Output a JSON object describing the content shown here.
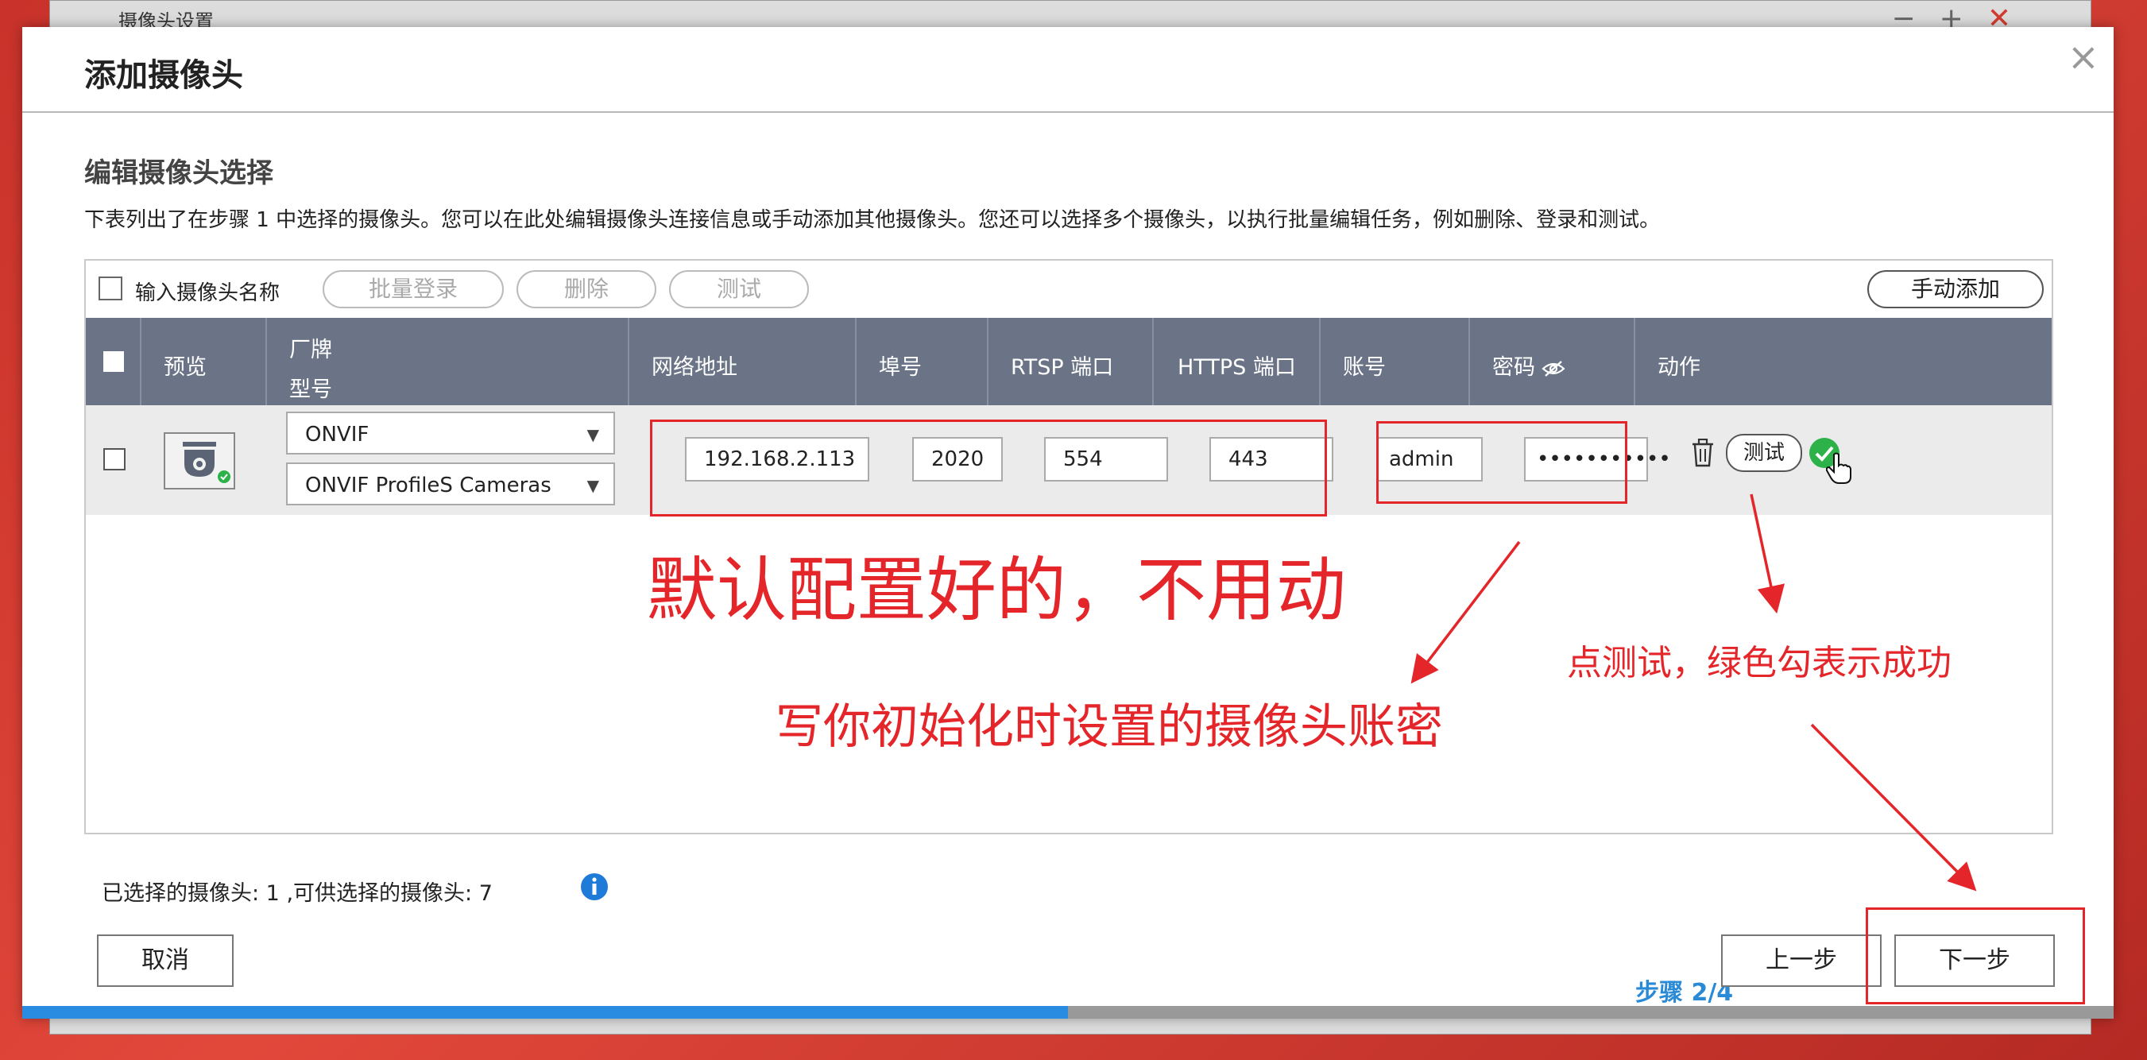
{
  "background_window": {
    "title": "摄像头设置"
  },
  "dialog": {
    "title": "添加摄像头",
    "section_title": "编辑摄像头选择",
    "description": "下表列出了在步骤 1 中选择的摄像头。您可以在此处编辑摄像头连接信息或手动添加其他摄像头。您还可以选择多个摄像头，以执行批量编辑任务，例如删除、登录和测试。"
  },
  "toolbar": {
    "name_label": "输入摄像头名称",
    "batch_login": "批量登录",
    "delete": "删除",
    "test": "测试",
    "manual_add": "手动添加"
  },
  "table": {
    "headers": {
      "preview": "预览",
      "brand": "厂牌",
      "model": "型号",
      "network_address": "网络地址",
      "port": "埠号",
      "rtsp_port": "RTSP 端口",
      "https_port": "HTTPS 端口",
      "account": "账号",
      "password": "密码",
      "action": "动作"
    },
    "row": {
      "brand": "ONVIF",
      "model": "ONVIF ProfileS Cameras",
      "ip": "192.168.2.113",
      "port": "2020",
      "rtsp": "554",
      "https": "443",
      "account": "admin",
      "password_mask": "•••••••••••",
      "test": "测试"
    }
  },
  "summary": {
    "text": "已选择的摄像头:  1  ,可供选择的摄像头:  7"
  },
  "footer": {
    "cancel": "取消",
    "step": "步骤 2/4",
    "prev": "上一步",
    "next": "下一步"
  },
  "progress": {
    "fraction": 0.5
  },
  "annotations": {
    "default_config": "默认配置好的，不用动",
    "account_hint": "写你初始化时设置的摄像头账密",
    "test_hint": "点测试，绿色勾表示成功"
  },
  "colors": {
    "header_bg": "#6a7486",
    "annotation_red": "#e4262a",
    "progress_blue": "#2a8ce0",
    "step_blue": "#2a8ad6",
    "success_green": "#2db24a"
  }
}
